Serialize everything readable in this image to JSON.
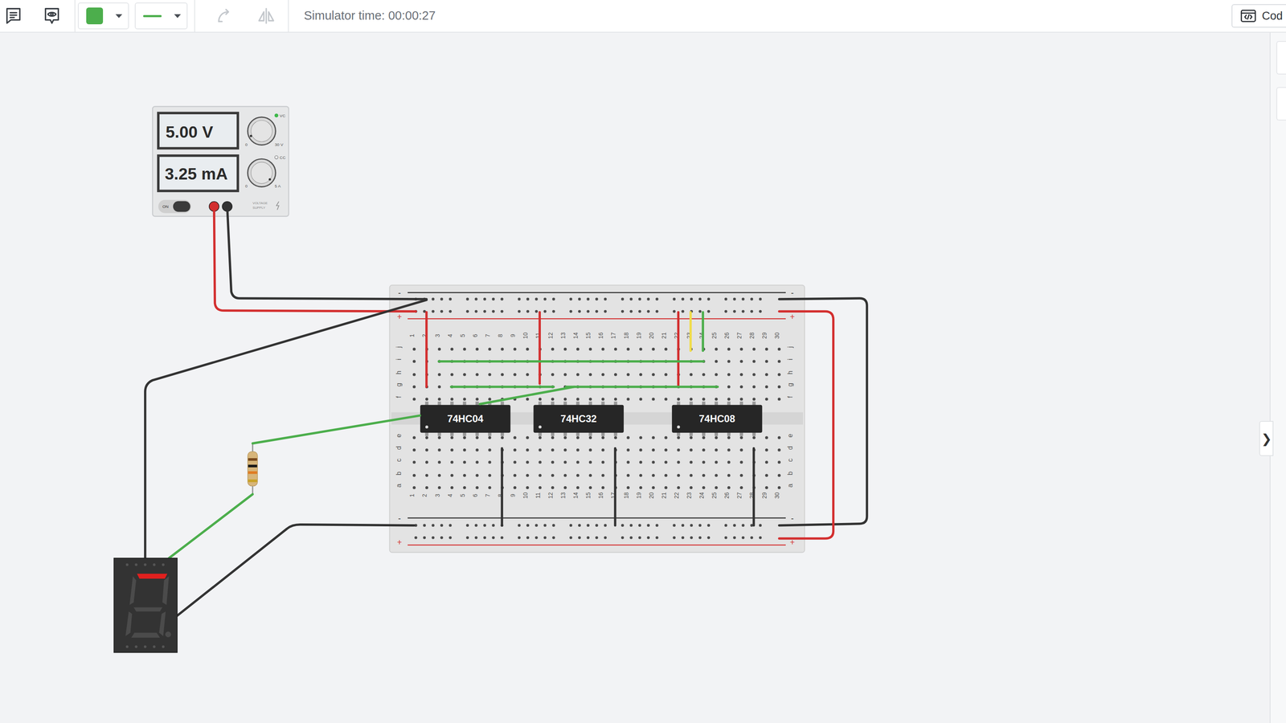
{
  "toolbar": {
    "tools_left": [
      {
        "kind": "notes",
        "disabled": false
      },
      {
        "kind": "comments",
        "disabled": false
      }
    ],
    "wire_color": {
      "color": "#4cae4c"
    },
    "wire_style": {
      "color": "#4cae4c"
    },
    "tools_edit": [
      {
        "kind": "rotate",
        "disabled": true
      },
      {
        "kind": "flip",
        "disabled": true
      }
    ],
    "simulator_time": "Simulator time: 00:00:27",
    "code_button": "Cod"
  },
  "panel_toggle": "❯",
  "power_supply": {
    "voltage": "5.00 V",
    "current": "3.25 mA",
    "knobs": [
      {
        "label": "VC",
        "min": "0",
        "max": "30 V",
        "active": true
      },
      {
        "label": "CC",
        "min": "0",
        "max": "5 A",
        "active": false
      }
    ],
    "switch": {
      "label": "ON",
      "on": true
    },
    "brand": [
      "VOLTAGE",
      "SUPPLY"
    ],
    "terminals": [
      {
        "color": "#d32f2f"
      },
      {
        "color": "#333333"
      }
    ]
  },
  "breadboard": {
    "columns": [
      "1",
      "2",
      "3",
      "4",
      "5",
      "6",
      "7",
      "8",
      "9",
      "10",
      "11",
      "12",
      "13",
      "14",
      "15",
      "16",
      "17",
      "18",
      "19",
      "20",
      "21",
      "22",
      "23",
      "24",
      "25",
      "26",
      "27",
      "28",
      "29",
      "30"
    ],
    "rows_top": [
      "j",
      "i",
      "h",
      "g",
      "f"
    ],
    "rows_bottom": [
      "e",
      "d",
      "c",
      "b",
      "a"
    ],
    "rail_signs": [
      "-",
      "+"
    ]
  },
  "chips": [
    {
      "label": "74HC04"
    },
    {
      "label": "74HC32"
    },
    {
      "label": "74HC08"
    }
  ],
  "resistor": {
    "bands": [
      {
        "color": "#7a4a1e"
      },
      {
        "color": "#1a1a1a"
      },
      {
        "color": "#e07b24"
      },
      {
        "color": "#c9a227"
      }
    ]
  },
  "wires": [
    {
      "color": "#d32f2f"
    },
    {
      "color": "#333333"
    },
    {
      "color": "#333333"
    },
    {
      "color": "#d32f2f"
    },
    {
      "color": "#d32f2f"
    },
    {
      "color": "#d32f2f"
    },
    {
      "color": "#f0dc4a"
    },
    {
      "color": "#4cae4c"
    },
    {
      "color": "#4cae4c"
    },
    {
      "color": "#4cae4c"
    },
    {
      "color": "#4cae4c"
    },
    {
      "color": "#4cae4c"
    },
    {
      "color": "#4cae4c"
    },
    {
      "color": "#4cae4c"
    },
    {
      "color": "#333333"
    },
    {
      "color": "#333333"
    },
    {
      "color": "#333333"
    },
    {
      "color": "#333333"
    },
    {
      "color": "#333333"
    },
    {
      "color": "#d32f2f"
    }
  ],
  "display": {
    "segments": [
      {
        "name": "a",
        "on": true
      },
      {
        "name": "b",
        "on": false
      },
      {
        "name": "c",
        "on": false
      },
      {
        "name": "d",
        "on": false
      },
      {
        "name": "e",
        "on": false
      },
      {
        "name": "f",
        "on": false
      },
      {
        "name": "g",
        "on": false
      }
    ],
    "dp": {
      "on": false
    }
  }
}
